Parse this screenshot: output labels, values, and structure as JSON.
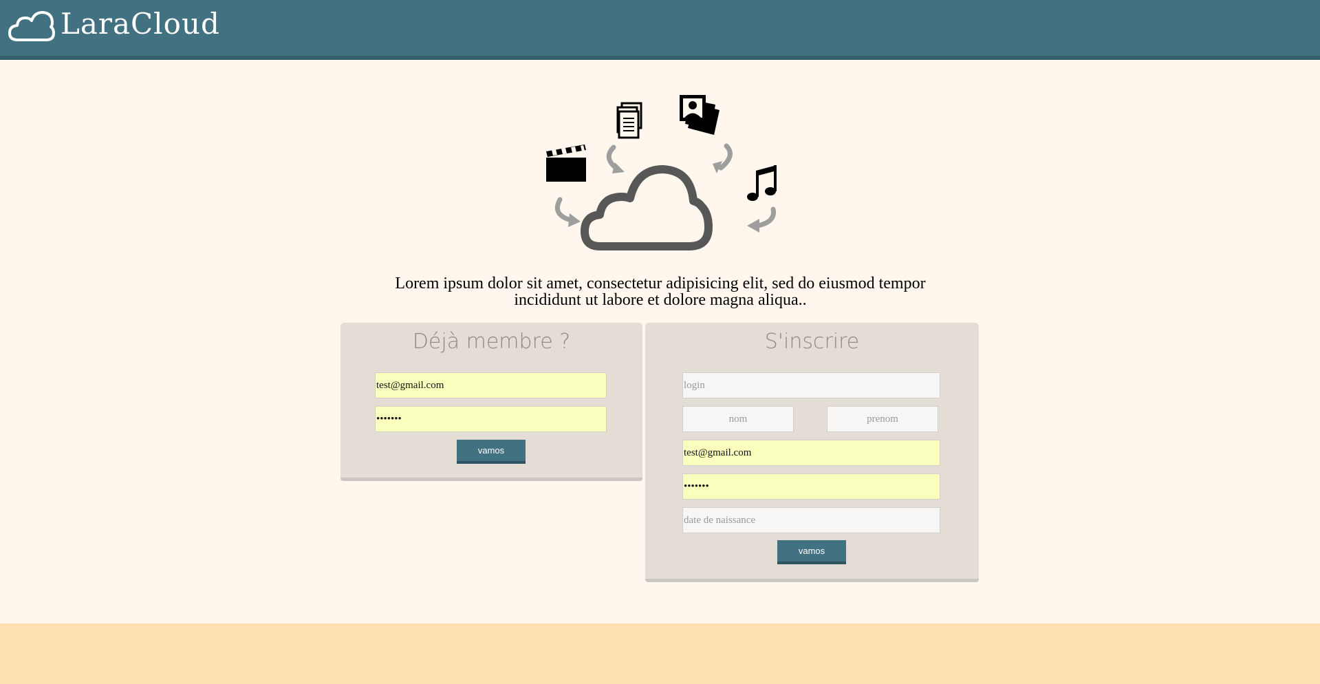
{
  "header": {
    "brand": "LaraCloud",
    "logo_icon": "cloud-icon",
    "background": "#427282"
  },
  "hero": {
    "icons": [
      "clapperboard-icon",
      "documents-icon",
      "photos-icon",
      "music-note-icon",
      "cloud-icon",
      "curved-arrow-icon"
    ],
    "tagline_line1": "Lorem ipsum dolor sit amet, consectetur adipisicing elit, sed do eiusmod tempor",
    "tagline_line2": "incididunt ut labore et dolore magna aliqua.."
  },
  "login": {
    "title": "Déjà membre ?",
    "email_value": "test@gmail.com",
    "password_value": "•••••••",
    "submit_label": "vamos"
  },
  "register": {
    "title": "S'inscrire",
    "login_placeholder": "login",
    "nom_placeholder": "nom",
    "prenom_placeholder": "prenom",
    "email_value": "test@gmail.com",
    "password_value": "•••••••",
    "birthdate_placeholder": "date de naissance",
    "submit_label": "vamos"
  },
  "colors": {
    "accent": "#427282",
    "page_bg": "#fff7ed",
    "panel_bg": "#e4ddd6",
    "autofill_bg": "#fbffbd",
    "footer_bg": "#ffe0b1"
  }
}
